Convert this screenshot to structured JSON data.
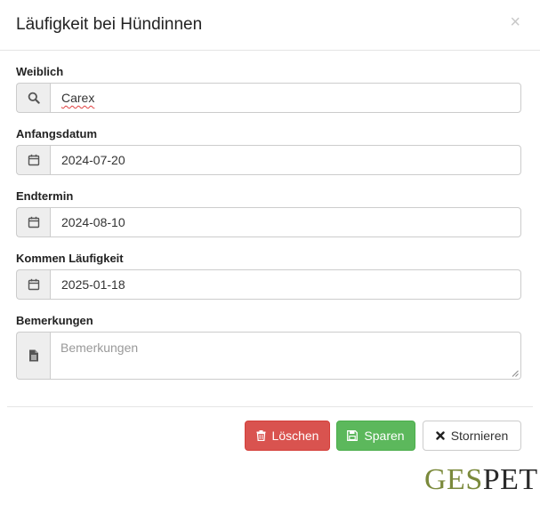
{
  "modal": {
    "title": "Läufigkeit bei Hündinnen",
    "close_label": "×"
  },
  "fields": {
    "female": {
      "label": "Weiblich",
      "value": "Carex",
      "icon": "search-icon"
    },
    "start_date": {
      "label": "Anfangsdatum",
      "value": "2024-07-20",
      "icon": "calendar-icon"
    },
    "end_date": {
      "label": "Endtermin",
      "value": "2024-08-10",
      "icon": "calendar-icon"
    },
    "next_heat": {
      "label": "Kommen Läufigkeit",
      "value": "2025-01-18",
      "icon": "calendar-icon"
    },
    "remarks": {
      "label": "Bemerkungen",
      "placeholder": "Bemerkungen",
      "icon": "document-icon"
    }
  },
  "buttons": {
    "delete_label": "Löschen",
    "save_label": "Sparen",
    "cancel_label": "Stornieren"
  },
  "logo": {
    "part1": "GES",
    "part2": "PET"
  },
  "colors": {
    "danger": "#d9534f",
    "success": "#5cb85c",
    "logo_green": "#7b8a3c"
  }
}
